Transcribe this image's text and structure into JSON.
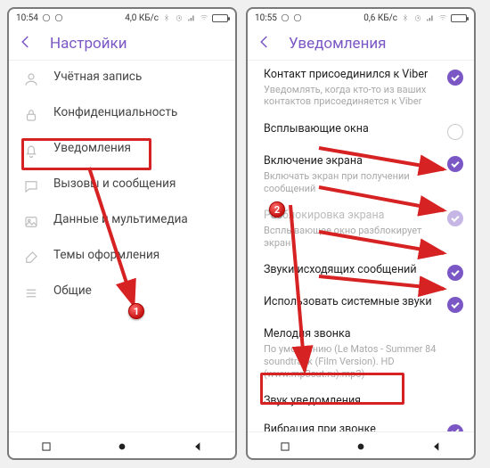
{
  "left_phone": {
    "status": {
      "time": "10:54",
      "net": "4,0 КБ/с"
    },
    "header": {
      "title": "Настройки"
    },
    "rows": [
      {
        "label": "Учётная запись"
      },
      {
        "label": "Конфиденциальность"
      },
      {
        "label": "Уведомления"
      },
      {
        "label": "Вызовы и сообщения"
      },
      {
        "label": "Данные и мультимедиа"
      },
      {
        "label": "Темы оформления"
      },
      {
        "label": "Общие"
      }
    ]
  },
  "right_phone": {
    "status": {
      "time": "10:55",
      "net": "0,6 КБ/с"
    },
    "header": {
      "title": "Уведомления"
    },
    "rows": [
      {
        "label": "Контакт присоединился к Viber",
        "sub": "Уведомлять, когда кто-то из ваших контактов присоединяется к Viber",
        "toggle": "on"
      },
      {
        "label": "Всплывающие окна",
        "toggle": "off"
      },
      {
        "label": "Включение экрана",
        "sub": "Включать экран при получении сообщений",
        "toggle": "on"
      },
      {
        "label": "Разблокировка экрана",
        "sub": "Всплывающее окно разблокирует экран",
        "toggle": "dim"
      },
      {
        "label": "Звуки исходящих сообщений",
        "toggle": "on"
      },
      {
        "label": "Использовать системные звуки",
        "toggle": "on"
      },
      {
        "label": "Мелодия звонка",
        "sub": "По умолчанию (Le Matos - Summer 84 soundtrack (Film Version). HD (www.mp3cut.ru).mp3)"
      },
      {
        "label": "Звук уведомления"
      },
      {
        "label": "Вибрация при звонке",
        "toggle": "on"
      }
    ]
  },
  "callouts": {
    "c1": "1",
    "c2": "2"
  }
}
